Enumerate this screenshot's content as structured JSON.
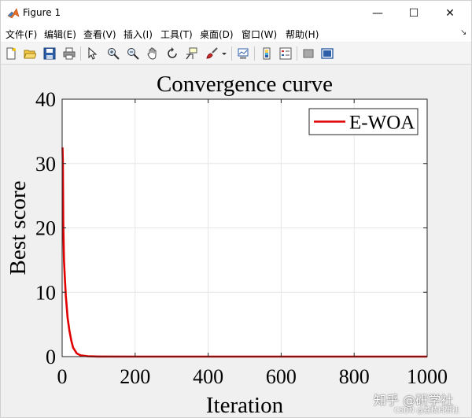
{
  "window": {
    "title": "Figure 1",
    "minimize_glyph": "—",
    "maximize_glyph": "☐",
    "close_glyph": "✕"
  },
  "menu": {
    "items": [
      "文件(F)",
      "编辑(E)",
      "查看(V)",
      "插入(I)",
      "工具(T)",
      "桌面(D)",
      "窗口(W)",
      "帮助(H)"
    ],
    "dock_glyph": "↘"
  },
  "toolbar": {
    "icons": [
      "new-figure-icon",
      "open-file-icon",
      "save-icon",
      "print-icon",
      "pointer-icon",
      "zoom-in-icon",
      "zoom-out-icon",
      "pan-icon",
      "rotate-3d-icon",
      "data-cursor-icon",
      "brush-icon",
      "link-plot-icon",
      "colorbar-icon",
      "legend-icon",
      "hide-plot-tools-icon",
      "show-plot-tools-icon"
    ]
  },
  "chart_data": {
    "type": "line",
    "title": "Convergence curve",
    "xlabel": "Iteration",
    "ylabel": "Best score",
    "xlim": [
      0,
      1000
    ],
    "ylim": [
      0,
      40
    ],
    "xticks": [
      "0",
      "200",
      "400",
      "600",
      "800",
      "1000"
    ],
    "yticks": [
      "0",
      "10",
      "20",
      "30",
      "40"
    ],
    "grid": true,
    "legend_position": "top-right",
    "series": [
      {
        "name": "E-WOA",
        "color": "#e00000",
        "x": [
          1,
          2,
          3,
          5,
          8,
          10,
          15,
          20,
          25,
          30,
          40,
          50,
          70,
          100,
          200,
          400,
          600,
          800,
          1000
        ],
        "y": [
          32.5,
          30.0,
          21.0,
          15.0,
          11.5,
          9.5,
          6.0,
          4.0,
          2.5,
          1.4,
          0.5,
          0.2,
          0.05,
          0.01,
          0,
          0,
          0,
          0,
          0
        ]
      }
    ]
  },
  "watermark": {
    "text": "知乎 @研学社",
    "sub": "CSDN @荔枝科研社"
  }
}
